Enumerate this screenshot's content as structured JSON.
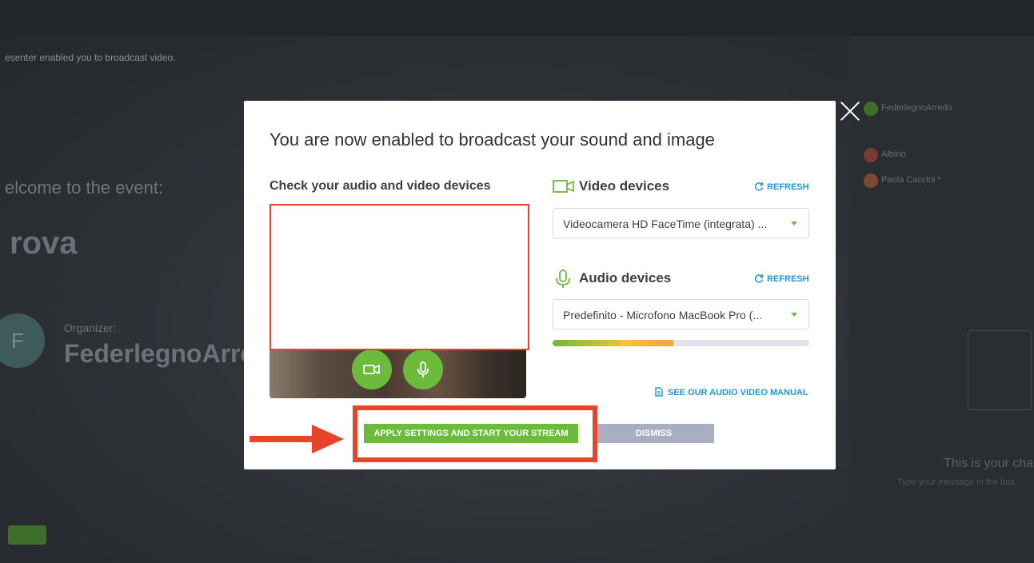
{
  "background": {
    "topbar_left": "",
    "topbar_right": "",
    "notice": "esenter enabled you to broadcast video.",
    "welcome": "elcome to the event:",
    "event_name": "rova",
    "organizer_label": "Organizer:",
    "organizer_name": "FederlegnoArre",
    "live_badge": "",
    "sidebar": {
      "title": "",
      "users": [
        {
          "name": "FederlegnoArredo",
          "color": "#3e6e2c"
        },
        {
          "name": "Albino",
          "color": "#7a3b33"
        },
        {
          "name": "Paola Caccini *",
          "color": "#7a4a33"
        }
      ],
      "tab": "",
      "chat_empty_title": "This is your cha",
      "chat_empty_text": "Type your message in the box"
    }
  },
  "modal": {
    "title": "You are now enabled to broadcast your sound and image",
    "subtitle": "Check your audio and video devices",
    "video": {
      "heading": "Video devices",
      "refresh_label": "REFRESH",
      "selected": "Videocamera HD FaceTime (integrata) ..."
    },
    "audio": {
      "heading": "Audio devices",
      "refresh_label": "REFRESH",
      "selected": "Predefinito - Microfono MacBook Pro (...",
      "level_percent": 47
    },
    "manual_link": "SEE OUR AUDIO VIDEO MANUAL",
    "apply_button": "APPLY SETTINGS AND START YOUR STREAM",
    "dismiss_button": "DISMISS"
  },
  "colors": {
    "accent_green": "#6cbb3c",
    "link_blue": "#2196d3",
    "highlight_red": "#e8442c",
    "dismiss_gray": "#a9afc0"
  }
}
